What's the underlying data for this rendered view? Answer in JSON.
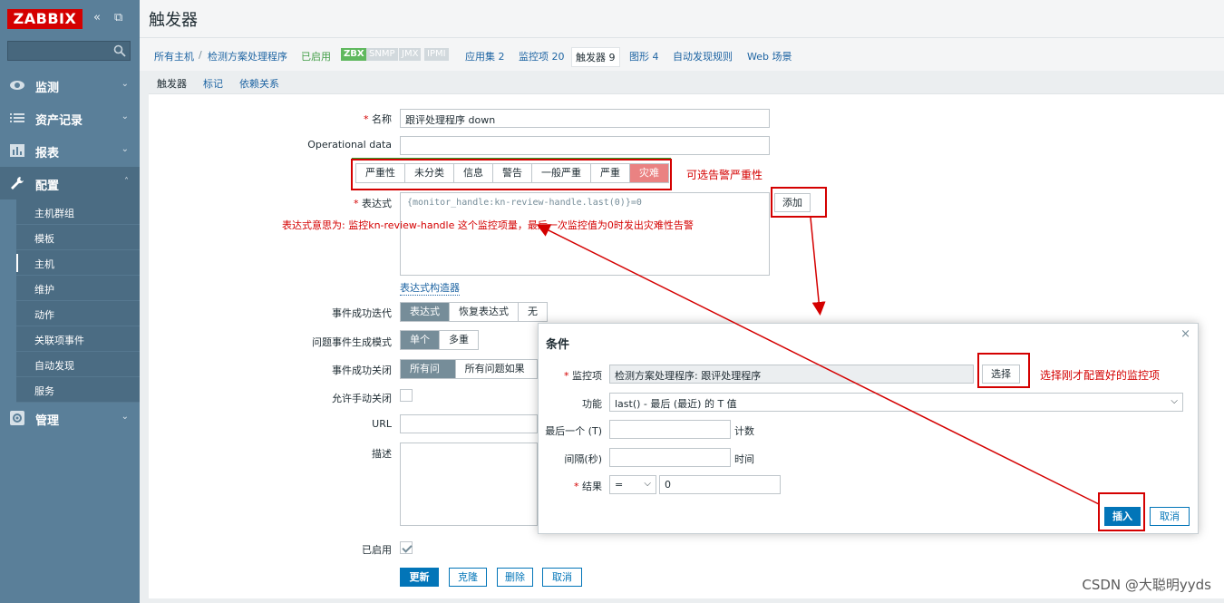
{
  "app": {
    "logo": "ZABBIX",
    "collapse_icon": "«",
    "fullscreen_icon": "⧉"
  },
  "sidebar": {
    "menu": [
      {
        "label": "监测",
        "icon": "eye-icon"
      },
      {
        "label": "资产记录",
        "icon": "list-icon"
      },
      {
        "label": "报表",
        "icon": "bar-chart-icon"
      },
      {
        "label": "配置",
        "icon": "wrench-icon"
      },
      {
        "label": "管理",
        "icon": "gear-icon"
      }
    ],
    "submenu": [
      "主机群组",
      "模板",
      "主机",
      "维护",
      "动作",
      "关联项事件",
      "自动发现",
      "服务"
    ]
  },
  "header": {
    "title": "触发器"
  },
  "breadcrumb": {
    "all_hosts": "所有主机",
    "sep": "/",
    "host": "检测方案处理程序",
    "enabled": "已启用",
    "tags": [
      "ZBX",
      "SNMP",
      "JMX",
      "IPMI"
    ],
    "apps": "应用集 2",
    "items": "监控项 20",
    "triggers": "触发器 9",
    "graphs": "图形 4",
    "discovery": "自动发现规则",
    "web": "Web 场景"
  },
  "tabs": [
    "触发器",
    "标记",
    "依赖关系"
  ],
  "form": {
    "name_label": "名称",
    "name_value": "跟评处理程序 down",
    "opdata_label": "Operational data",
    "opdata_value": "",
    "severity_label": "严重性",
    "severities": [
      "未分类",
      "信息",
      "警告",
      "一般严重",
      "严重",
      "灾难"
    ],
    "expression_label": "表达式",
    "expression_value": "{monitor_handle:kn-review-handle.last(0)}=0",
    "add_button": "添加",
    "expr_builder": "表达式构造器",
    "ok_event_label": "事件成功迭代",
    "ok_event_options": [
      "表达式",
      "恢复表达式",
      "无"
    ],
    "problem_mode_label": "问题事件生成模式",
    "problem_mode_options": [
      "单个",
      "多重"
    ],
    "ok_close_label": "事件成功关闭",
    "ok_close_options": [
      "所有问题",
      "所有问题如果标"
    ],
    "manual_close_label": "允许手动关闭",
    "url_label": "URL",
    "url_value": "",
    "desc_label": "描述",
    "enabled_label": "已启用",
    "buttons": {
      "update": "更新",
      "clone": "克隆",
      "delete": "删除",
      "cancel": "取消"
    }
  },
  "dialog": {
    "title": "条件",
    "close": "×",
    "item_label": "监控项",
    "item_value": "检测方案处理程序: 跟评处理程序",
    "select_button": "选择",
    "function_label": "功能",
    "function_value": "last() - 最后 (最近) 的 T 值",
    "last_label": "最后一个 (T)",
    "last_value": "",
    "last_unit": "计数",
    "interval_label": "间隔(秒)",
    "interval_value": "",
    "interval_unit": "时间",
    "result_label": "结果",
    "result_op": "=",
    "result_value": "0",
    "insert_button": "插入",
    "cancel_button": "取消"
  },
  "annotations": {
    "severity_note": "可选告警严重性",
    "expression_note": "表达式意思为: 监控kn-review-handle 这个监控项量，最后一次监控值为0时发出灾难性告警",
    "item_note": "选择刚才配置好的监控项",
    "color": "#d40000"
  },
  "watermark": "CSDN @大聪明yyds"
}
